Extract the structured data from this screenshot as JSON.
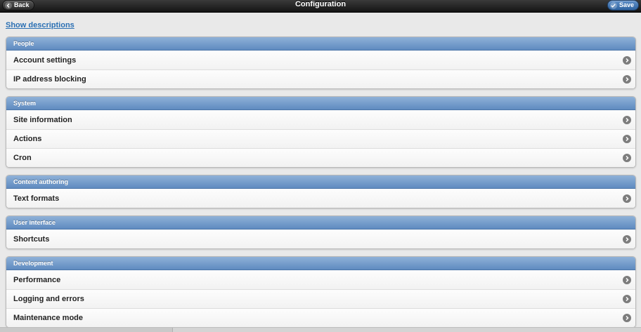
{
  "header": {
    "title": "Configuration",
    "back_label": "Back",
    "save_label": "Save"
  },
  "show_descriptions_label": "Show descriptions",
  "groups": [
    {
      "title": "People",
      "items": [
        "Account settings",
        "IP address blocking"
      ]
    },
    {
      "title": "System",
      "items": [
        "Site information",
        "Actions",
        "Cron"
      ]
    },
    {
      "title": "Content authoring",
      "items": [
        "Text formats"
      ]
    },
    {
      "title": "User interface",
      "items": [
        "Shortcuts"
      ]
    },
    {
      "title": "Development",
      "items": [
        "Performance",
        "Logging and errors",
        "Maintenance mode"
      ]
    }
  ],
  "colors": {
    "header_blue": "#6f99c9",
    "link_blue": "#2a6fb3",
    "save_blue": "#3f74b3"
  }
}
